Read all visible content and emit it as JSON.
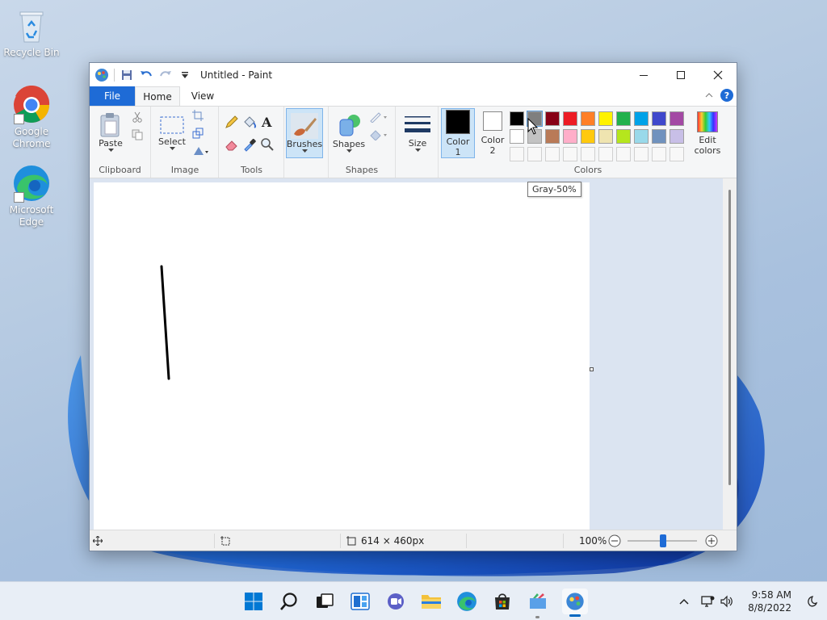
{
  "desktop": {
    "icons": [
      {
        "label": "Recycle Bin",
        "icon": "recycle-bin-icon"
      },
      {
        "label": "Google Chrome",
        "icon": "chrome-icon"
      },
      {
        "label": "Microsoft Edge",
        "icon": "edge-icon"
      }
    ]
  },
  "window": {
    "title": "Untitled - Paint",
    "tabs": [
      {
        "label": "File"
      },
      {
        "label": "Home"
      },
      {
        "label": "View"
      }
    ]
  },
  "ribbon": {
    "clipboard": {
      "paste": "Paste",
      "group": "Clipboard"
    },
    "image": {
      "select": "Select",
      "group": "Image"
    },
    "tools": {
      "group": "Tools"
    },
    "brushes": {
      "label": "Brushes"
    },
    "shapes": {
      "label": "Shapes",
      "group": "Shapes"
    },
    "size": {
      "label": "Size"
    },
    "colors": {
      "color1": "Color 1",
      "color2": "Color 2",
      "edit": "Edit colors",
      "group": "Colors",
      "color1_value": "#000000",
      "color2_value": "#ffffff",
      "palette_row1": [
        "#000000",
        "#7f7f7f",
        "#880015",
        "#ed1c24",
        "#ff7f27",
        "#fff200",
        "#22b14c",
        "#00a2e8",
        "#3f48cc",
        "#a349a4"
      ],
      "palette_row2": [
        "#ffffff",
        "#c3c3c3",
        "#b97a57",
        "#ffaec9",
        "#ffc90e",
        "#efe4b0",
        "#b5e61d",
        "#99d9ea",
        "#7092be",
        "#c8bfe7"
      ]
    }
  },
  "tooltip": "Gray-50%",
  "status": {
    "dimensions": "614 × 460px",
    "zoom": "100%"
  },
  "taskbar": {
    "time": "9:58 AM",
    "date": "8/8/2022"
  }
}
